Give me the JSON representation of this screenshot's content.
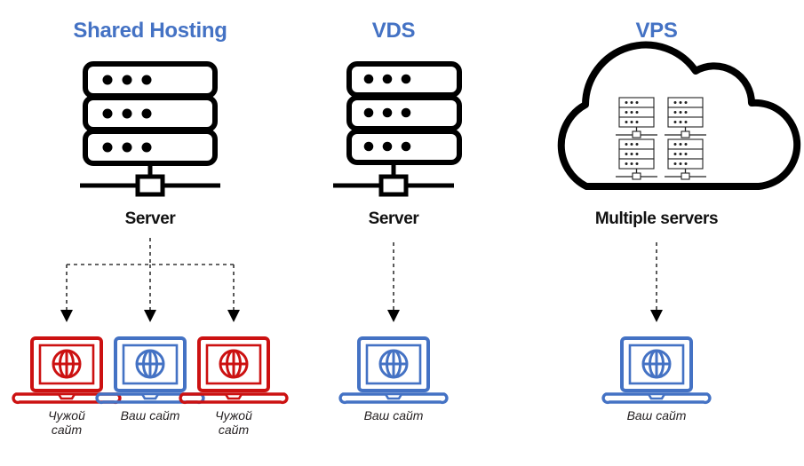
{
  "diagram": {
    "title_color": "#4472C4",
    "label_color": "#111111",
    "your_site_color": "#4472C4",
    "foreign_site_color": "#CC1111",
    "arrow_color": "#333333",
    "columns": [
      {
        "id": "shared-hosting",
        "title": "Shared Hosting",
        "server_label": "Server",
        "server_icon": "rack-server-icon",
        "rack_count": 3,
        "dots_per_rack": 3,
        "sites": [
          {
            "caption": "Чужой сайт",
            "caption_lines": [
              "Чужой",
              "сайт"
            ],
            "owner": "foreign",
            "color": "#CC1111",
            "icon": "laptop-globe-icon"
          },
          {
            "caption": "Ваш сайт",
            "caption_lines": [
              "Ваш сайт"
            ],
            "owner": "yours",
            "color": "#4472C4",
            "icon": "laptop-globe-icon"
          },
          {
            "caption": "Чужой сайт",
            "caption_lines": [
              "Чужой",
              "сайт"
            ],
            "owner": "foreign",
            "color": "#CC1111",
            "icon": "laptop-globe-icon"
          }
        ]
      },
      {
        "id": "vds",
        "title": "VDS",
        "server_label": "Server",
        "server_icon": "rack-server-icon",
        "rack_count": 3,
        "dots_per_rack": 3,
        "sites": [
          {
            "caption": "Ваш сайт",
            "caption_lines": [
              "Ваш сайт"
            ],
            "owner": "yours",
            "color": "#4472C4",
            "icon": "laptop-globe-icon"
          }
        ]
      },
      {
        "id": "vps",
        "title": "VPS",
        "server_label": "Multiple servers",
        "server_icon": "cloud-servers-icon",
        "cloud_server_count": 4,
        "sites": [
          {
            "caption": "Ваш сайт",
            "caption_lines": [
              "Ваш сайт"
            ],
            "owner": "yours",
            "color": "#4472C4",
            "icon": "laptop-globe-icon"
          }
        ]
      }
    ]
  }
}
